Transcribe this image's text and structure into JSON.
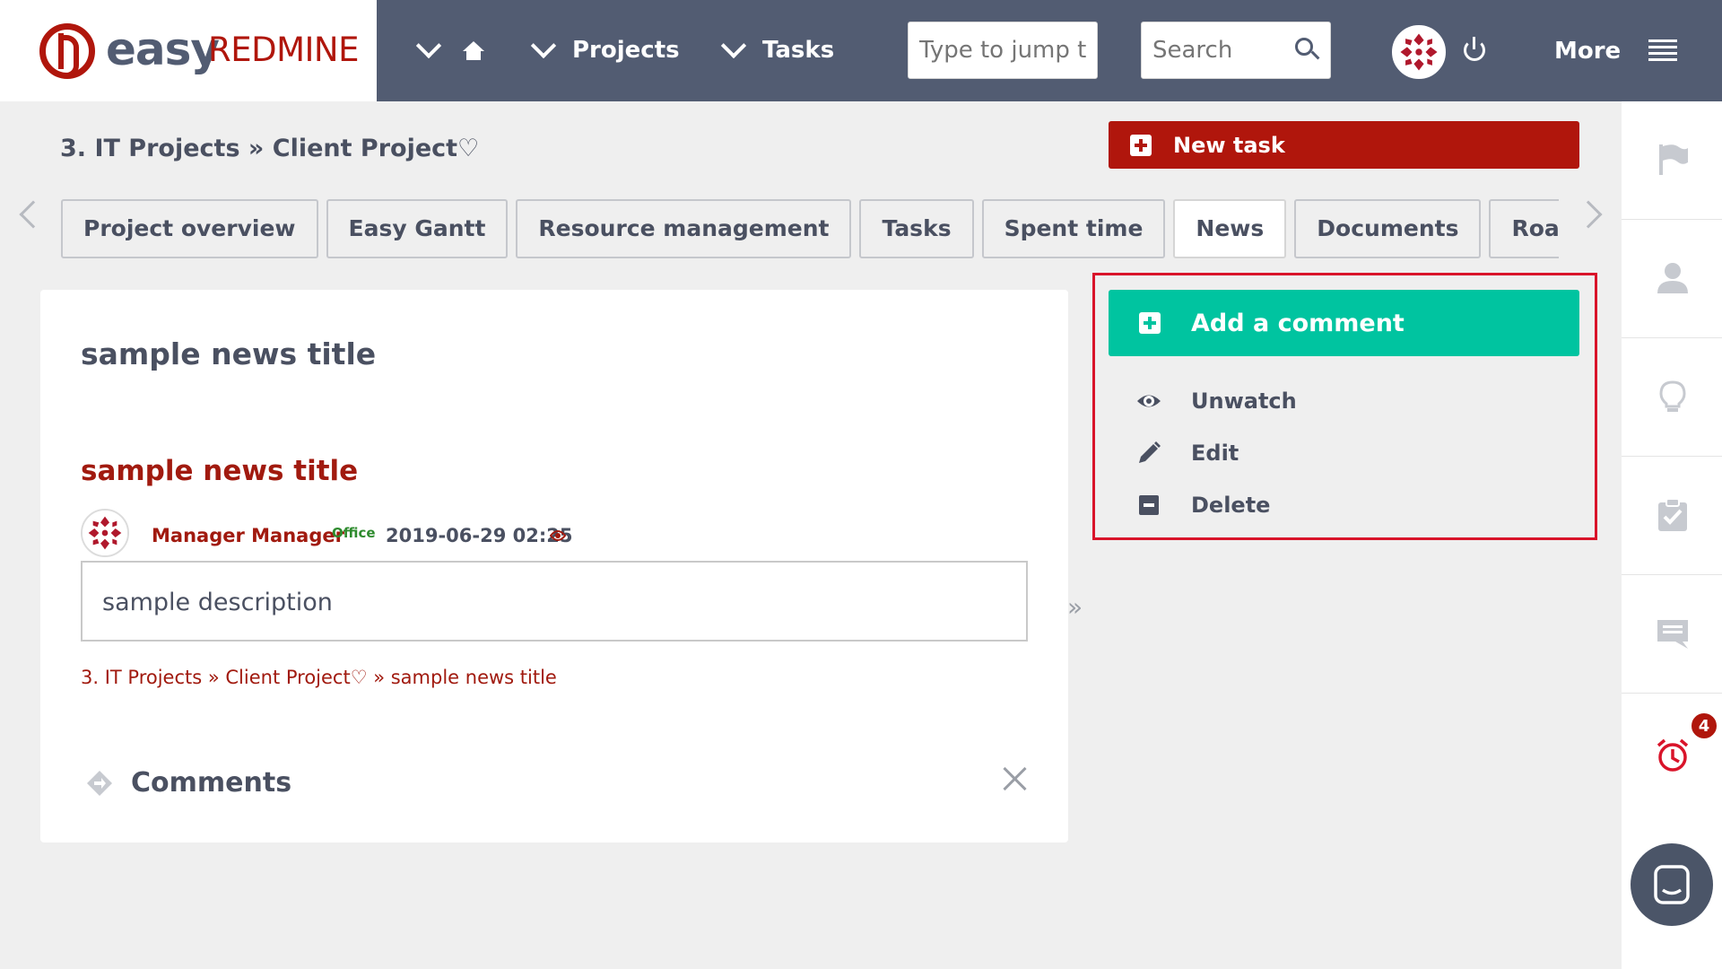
{
  "app": {
    "logo_easy": "easy",
    "logo_redmine": "REDMINE"
  },
  "topnav": {
    "projects": "Projects",
    "tasks": "Tasks",
    "jump_placeholder": "Type to jump t",
    "search_placeholder": "Search",
    "more": "More"
  },
  "breadcrumb": {
    "text": "3. IT Projects » Client Project♡"
  },
  "buttons": {
    "new_task": "New task"
  },
  "tabs": [
    "Project overview",
    "Easy Gantt",
    "Resource management",
    "Tasks",
    "Spent time",
    "News",
    "Documents",
    "Roadmap"
  ],
  "active_tab": "News",
  "news": {
    "page_title": "sample news title",
    "title": "sample news title",
    "author": "Manager Manager",
    "author_tag": "Office",
    "date": "2019-06-29 02:25",
    "description": "sample description",
    "crumb": "3. IT Projects » Client Project♡ » sample news title",
    "comments_label": "Comments"
  },
  "actions": {
    "add_comment": "Add a comment",
    "unwatch": "Unwatch",
    "edit": "Edit",
    "delete": "Delete"
  },
  "rail": {
    "badge_count": "4"
  },
  "colors": {
    "topbar": "#525c72",
    "brand_red": "#b0160c",
    "accent_green": "#00c4a0",
    "highlight_frame": "#d9142a"
  }
}
